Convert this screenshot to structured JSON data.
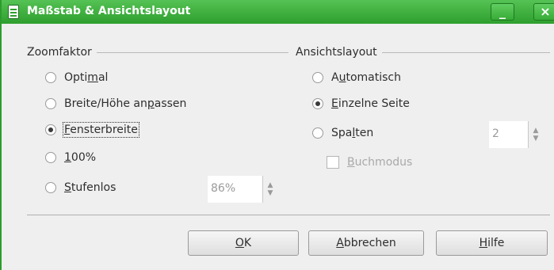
{
  "window": {
    "title": "Maßstab & Ansichtslayout",
    "title_icon": "document-icon",
    "minimize_symbol": "_",
    "close_symbol": "×"
  },
  "zoom": {
    "heading": "Zoomfaktor",
    "options": [
      {
        "pre": "Opti",
        "mn": "m",
        "post": "al",
        "checked": false
      },
      {
        "pre": "Breite/Höhe an",
        "mn": "p",
        "post": "assen",
        "checked": false
      },
      {
        "pre": "",
        "mn": "F",
        "post": "ensterbreite",
        "checked": true
      },
      {
        "pre": "",
        "mn": "1",
        "post": "00%",
        "checked": false
      },
      {
        "pre": "",
        "mn": "S",
        "post": "tufenlos",
        "checked": false
      }
    ],
    "variable_value": "86%"
  },
  "layout": {
    "heading": "Ansichtslayout",
    "options": [
      {
        "pre": "A",
        "mn": "u",
        "post": "tomatisch",
        "checked": false
      },
      {
        "pre": "",
        "mn": "E",
        "post": "inzelne Seite",
        "checked": true
      },
      {
        "pre": "Spa",
        "mn": "l",
        "post": "ten",
        "checked": false
      }
    ],
    "columns_value": "2",
    "book_mode": {
      "pre": "",
      "mn": "B",
      "post": "uchmodus",
      "checked": false,
      "enabled": false
    }
  },
  "buttons": {
    "ok": {
      "pre": "",
      "mn": "O",
      "post": "K"
    },
    "cancel": {
      "pre": "",
      "mn": "A",
      "post": "bbrechen"
    },
    "help": {
      "pre": "",
      "mn": "H",
      "post": "ilfe"
    }
  }
}
